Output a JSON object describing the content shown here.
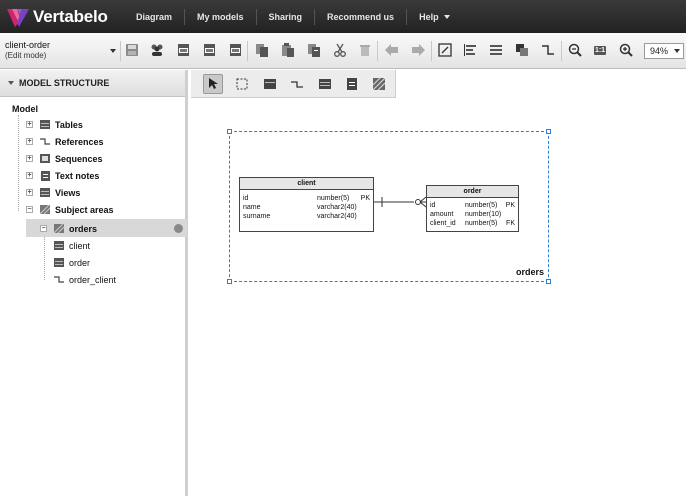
{
  "brand": {
    "name": "Vertabelo"
  },
  "nav": {
    "items": [
      "Diagram",
      "My models",
      "Sharing",
      "Recommend us",
      "Help"
    ]
  },
  "toolbar": {
    "model_name": "client-order",
    "mode": "(Edit mode)",
    "zoom": "94%",
    "zoom_100_label": "1:1",
    "tools": [
      "save",
      "share",
      "export-pdf",
      "export-sql",
      "export-svg",
      "copy",
      "paste",
      "clone",
      "cut",
      "delete",
      "undo",
      "redo",
      "format",
      "align",
      "distribute",
      "arrange",
      "line-style",
      "zoom-out",
      "zoom-100",
      "zoom-in"
    ]
  },
  "panel": {
    "title": "MODEL STRUCTURE",
    "root": "Model",
    "items": [
      {
        "label": "Tables"
      },
      {
        "label": "References"
      },
      {
        "label": "Sequences"
      },
      {
        "label": "Text notes"
      },
      {
        "label": "Views"
      },
      {
        "label": "Subject areas"
      }
    ],
    "subject_area": {
      "label": "orders"
    },
    "subject_children": [
      {
        "label": "client"
      },
      {
        "label": "order"
      },
      {
        "label": "order_client"
      }
    ]
  },
  "diagram": {
    "area_name": "orders",
    "tables": [
      {
        "name": "client",
        "columns": [
          {
            "name": "id",
            "type": "number(5)",
            "key": "PK"
          },
          {
            "name": "name",
            "type": "varchar2(40)",
            "key": ""
          },
          {
            "name": "surname",
            "type": "varchar2(40)",
            "key": ""
          }
        ]
      },
      {
        "name": "order",
        "columns": [
          {
            "name": "id",
            "type": "number(5)",
            "key": "PK"
          },
          {
            "name": "amount",
            "type": "number(10)",
            "key": ""
          },
          {
            "name": "client_id",
            "type": "number(5)",
            "key": "FK"
          }
        ]
      }
    ]
  }
}
